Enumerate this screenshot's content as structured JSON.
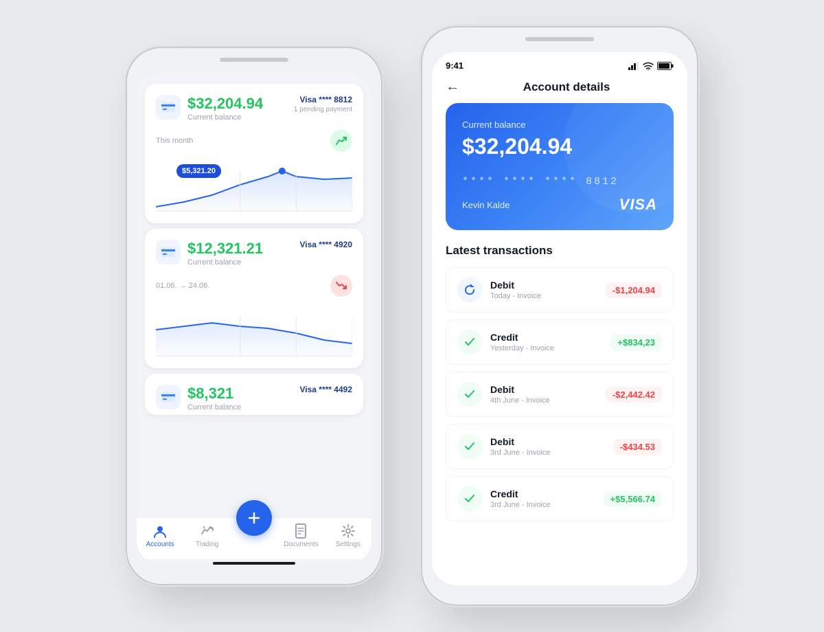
{
  "phone1": {
    "cards": [
      {
        "balance": "$32,204.94",
        "label": "Current balance",
        "visa": "Visa **** 8812",
        "pending": "1 pending payment",
        "period": "This month",
        "trend": "up",
        "chartTooltip": "$5,321.20"
      },
      {
        "balance": "$12,321.21",
        "label": "Current balance",
        "visa": "Visa **** 4920",
        "pending": "",
        "period": "01.06. → 24.06.",
        "trend": "down",
        "chartTooltip": ""
      },
      {
        "balance": "$8,321",
        "label": "Current balance",
        "visa": "Visa **** 4492",
        "pending": "",
        "period": "",
        "trend": "",
        "chartTooltip": ""
      }
    ],
    "nav": {
      "items": [
        {
          "label": "Accounts",
          "active": true
        },
        {
          "label": "Trading",
          "active": false
        },
        {
          "label": "",
          "fab": true
        },
        {
          "label": "Documents",
          "active": false
        },
        {
          "label": "Settings",
          "active": false
        }
      ]
    }
  },
  "phone2": {
    "status": {
      "time": "9:41"
    },
    "header": {
      "title": "Account details",
      "back": "←"
    },
    "card": {
      "label": "Current balance",
      "balance": "$32,204.94",
      "number": "**** **** **** 8812",
      "name": "Kevin Kalde",
      "brand": "VISA"
    },
    "transactions": {
      "title": "Latest transactions",
      "items": [
        {
          "type": "Debit",
          "date": "Today - Invoice",
          "amount": "-$1,204.94",
          "positive": false,
          "icon": "refresh"
        },
        {
          "type": "Credit",
          "date": "Yesterday - Invoice",
          "amount": "+$834,23",
          "positive": true,
          "icon": "check"
        },
        {
          "type": "Debit",
          "date": "4th June - Invoice",
          "amount": "-$2,442.42",
          "positive": false,
          "icon": "check"
        },
        {
          "type": "Debit",
          "date": "3rd June - Invoice",
          "amount": "-$434.53",
          "positive": false,
          "icon": "check"
        },
        {
          "type": "Credit",
          "date": "3rd June - Invoice",
          "amount": "+$5,566.74",
          "positive": true,
          "icon": "check"
        }
      ]
    }
  }
}
